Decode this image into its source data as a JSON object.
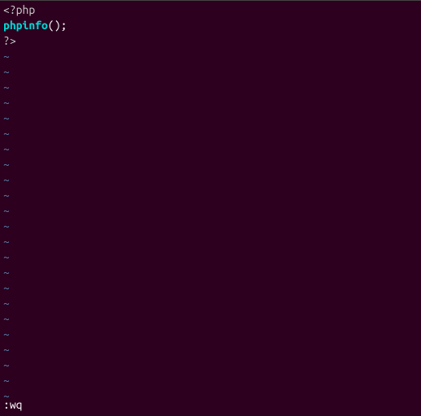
{
  "code": {
    "line1": "<?php",
    "line2_func": "phpinfo",
    "line2_parens": "()",
    "line2_semi": ";",
    "line3": "?>"
  },
  "empty_line_marker": "~",
  "empty_line_count": 23,
  "command": ":wq"
}
